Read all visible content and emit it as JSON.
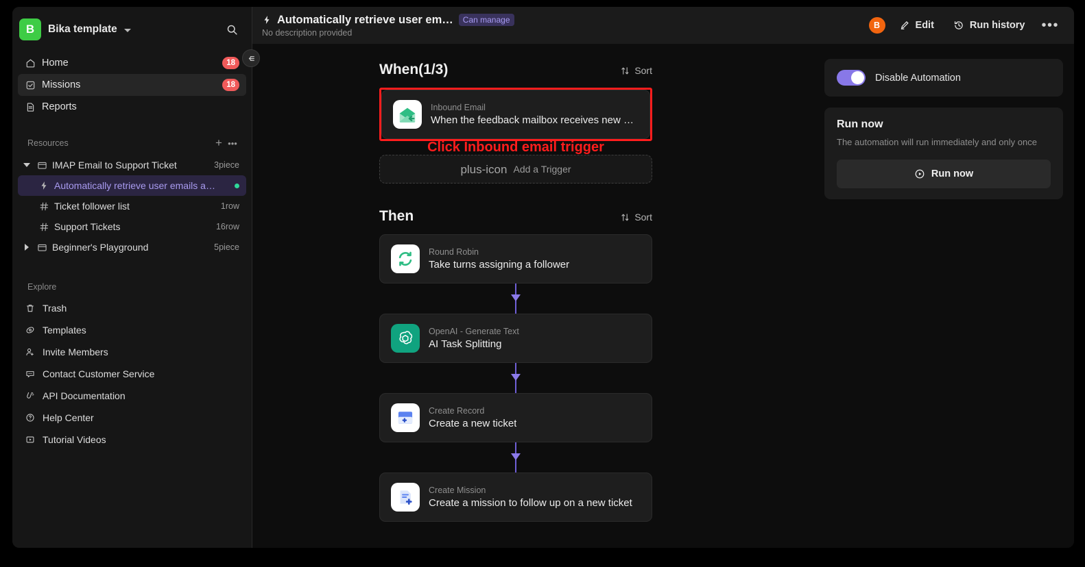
{
  "workspace": {
    "logo_letter": "B",
    "name": "Bika template",
    "search_icon": "search-icon",
    "chevron_icon": "chevron-down-icon"
  },
  "sidebar": {
    "nav": [
      {
        "label": "Home",
        "icon": "home-icon",
        "badge": "18",
        "active": false
      },
      {
        "label": "Missions",
        "icon": "checkbox-icon",
        "badge": "18",
        "active": true
      },
      {
        "label": "Reports",
        "icon": "document-icon",
        "badge": "",
        "active": false
      }
    ],
    "resources": {
      "title": "Resources",
      "add_label": "+",
      "more_label": "•••",
      "tree": [
        {
          "label": "IMAP Email to Support Ticket",
          "meta": "3piece",
          "icon": "folder-icon",
          "expanded": true,
          "child": false,
          "selected": false,
          "dot": false
        },
        {
          "label": "Automatically retrieve user emails a…",
          "meta": "",
          "icon": "bolt-icon",
          "expanded": null,
          "child": true,
          "selected": true,
          "dot": true
        },
        {
          "label": "Ticket follower list",
          "meta": "1row",
          "icon": "table-icon",
          "expanded": null,
          "child": true,
          "selected": false,
          "dot": false
        },
        {
          "label": "Support Tickets",
          "meta": "16row",
          "icon": "table-icon",
          "expanded": null,
          "child": true,
          "selected": false,
          "dot": false
        },
        {
          "label": "Beginner's Playground",
          "meta": "5piece",
          "icon": "folder-icon",
          "expanded": false,
          "child": false,
          "selected": false,
          "dot": false
        }
      ]
    },
    "explore": {
      "title": "Explore",
      "items": [
        {
          "label": "Trash",
          "icon": "trash-icon"
        },
        {
          "label": "Templates",
          "icon": "templates-icon"
        },
        {
          "label": "Invite Members",
          "icon": "user-plus-icon"
        },
        {
          "label": "Contact Customer Service",
          "icon": "chat-icon"
        },
        {
          "label": "API Documentation",
          "icon": "api-icon"
        },
        {
          "label": "Help Center",
          "icon": "question-circle-icon"
        },
        {
          "label": "Tutorial Videos",
          "icon": "play-box-icon"
        }
      ]
    },
    "collapse_icon": "collapse-sidebar-icon"
  },
  "topbar": {
    "bolt_icon": "bolt-icon",
    "title": "Automatically retrieve user em…",
    "permission_badge": "Can manage",
    "subtitle": "No description provided",
    "avatar_letter": "B",
    "edit_label": "Edit",
    "edit_icon": "pencil-icon",
    "run_history_label": "Run history",
    "run_history_icon": "history-icon",
    "more_label": "•••"
  },
  "flow": {
    "when": {
      "heading": "When(1/3)",
      "sort_label": "Sort",
      "sort_icon": "sort-icon",
      "trigger": {
        "kind": "Inbound Email",
        "name": "When the feedback mailbox receives new us…",
        "icon": "inbound-email-icon"
      },
      "annotation": "Click Inbound email trigger",
      "add_trigger_label": "Add a Trigger",
      "add_trigger_icon": "plus-icon"
    },
    "then": {
      "heading": "Then",
      "sort_label": "Sort",
      "sort_icon": "sort-icon",
      "actions": [
        {
          "kind": "Round Robin",
          "name": "Take turns assigning a follower",
          "icon": "round-robin-icon"
        },
        {
          "kind": "OpenAI - Generate Text",
          "name": "AI Task Splitting",
          "icon": "openai-icon"
        },
        {
          "kind": "Create Record",
          "name": "Create a new ticket",
          "icon": "create-record-icon"
        },
        {
          "kind": "Create Mission",
          "name": "Create a mission to follow up on a new ticket",
          "icon": "create-mission-icon"
        }
      ]
    }
  },
  "right_panel": {
    "disable_automation_label": "Disable Automation",
    "toggle_on": true,
    "run_now_title": "Run now",
    "run_now_desc": "The automation will run immediately and only once",
    "run_now_button": "Run now",
    "run_now_icon": "play-circle-icon"
  },
  "colors": {
    "brand_green": "#3ecc45",
    "accent_purple": "#8878e8",
    "badge_red": "#f05a5a",
    "avatar_orange": "#f2650f",
    "annotation_red": "#ff1d1d",
    "status_dot_green": "#2fd89a"
  }
}
